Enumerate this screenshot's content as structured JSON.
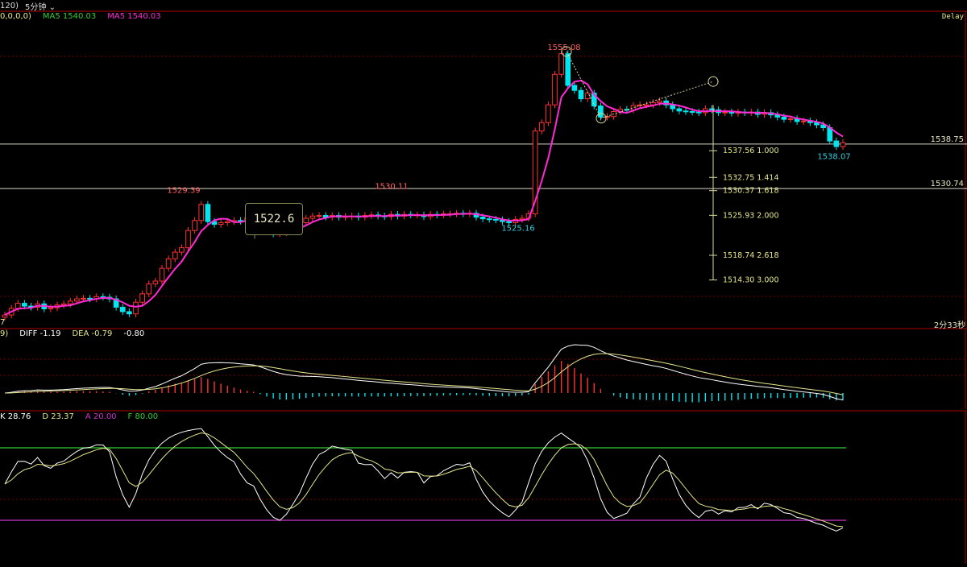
{
  "toolbar": {
    "left_fragment": "120)",
    "period": "5分钟"
  },
  "main_header": {
    "params": "0,0,0,0)",
    "ma5a": "MA5 1540.03",
    "ma5b": "MA5 1540.03",
    "delay": "Delay",
    "timer": "2分33秒",
    "bottom_left": "7"
  },
  "macd_header": {
    "params": "9)",
    "diff": "DIFF -1.19",
    "dea": "DEA -0.79",
    "macd": "-0.80"
  },
  "kd_header": {
    "k": "K 28.76",
    "d": "D 23.37",
    "a": "A 20.00",
    "f": "F 80.00"
  },
  "callout": "1522.6",
  "colors": {
    "up": "#ff3232",
    "down": "#00e5ee",
    "ma": "#ff2ad4",
    "line_white": "#ffffff",
    "line_yellow": "#e6e68a",
    "green_line": "#33cc33",
    "magenta_line": "#cc33cc",
    "grid": "#7a0000"
  },
  "chart_data": [
    {
      "type": "candlestick",
      "ylim": [
        1507,
        1558
      ],
      "price_labels": [
        {
          "text": "1529.39",
          "value": 1529.39
        },
        {
          "text": "1530.11",
          "value": 1530.11
        },
        {
          "text": "1525.16",
          "value": 1525.16
        },
        {
          "text": "1555.08",
          "value": 1555.08
        },
        {
          "text": "1538.07",
          "value": 1538.07
        }
      ],
      "hlines": [
        {
          "value": 1538.75,
          "label": "1538.75"
        },
        {
          "value": 1530.74,
          "label": "1530.74"
        }
      ],
      "fib_levels": [
        {
          "text": "1537.56  1.000",
          "value": 1537.56
        },
        {
          "text": "1532.75  1.414",
          "value": 1532.75
        },
        {
          "text": "1530.37  1.618",
          "value": 1530.37
        },
        {
          "text": "1525.93  2.000",
          "value": 1525.93
        },
        {
          "text": "1518.74  2.618",
          "value": 1518.74
        },
        {
          "text": "1514.30  3.000",
          "value": 1514.3
        }
      ],
      "close": [
        1508.0,
        1509.2,
        1510.1,
        1509.6,
        1509.4,
        1510.0,
        1509.1,
        1509.3,
        1509.8,
        1510.0,
        1510.5,
        1510.9,
        1511.0,
        1510.9,
        1511.3,
        1511.2,
        1510.9,
        1509.4,
        1508.6,
        1508.2,
        1510.3,
        1511.8,
        1513.6,
        1514.1,
        1516.4,
        1518.1,
        1519.3,
        1520.1,
        1523.2,
        1525.0,
        1527.9,
        1524.8,
        1524.3,
        1524.6,
        1524.8,
        1525.0,
        1524.9,
        1525.5,
        1525.8,
        1524.0,
        1523.0,
        1522.6,
        1522.8,
        1523.6,
        1524.2,
        1524.6,
        1525.4,
        1525.8,
        1525.9,
        1525.6,
        1525.9,
        1525.6,
        1525.7,
        1525.8,
        1525.6,
        1525.9,
        1526.0,
        1525.8,
        1525.7,
        1526.1,
        1525.8,
        1526.1,
        1526.0,
        1526.0,
        1525.7,
        1526.1,
        1526.0,
        1526.2,
        1526.2,
        1526.3,
        1526.2,
        1526.3,
        1525.6,
        1525.3,
        1525.2,
        1525.1,
        1524.8,
        1524.6,
        1525.2,
        1525.4,
        1526.2,
        1541.1,
        1542.6,
        1545.8,
        1551.3,
        1555.0,
        1549.3,
        1548.4,
        1546.9,
        1547.9,
        1545.6,
        1543.6,
        1543.7,
        1544.6,
        1545.0,
        1544.9,
        1545.7,
        1545.8,
        1545.8,
        1546.2,
        1546.5,
        1545.8,
        1545.1,
        1544.7,
        1544.6,
        1544.5,
        1544.4,
        1545.1,
        1544.9,
        1544.4,
        1544.5,
        1544.3,
        1544.5,
        1544.4,
        1544.5,
        1544.1,
        1544.4,
        1544.0,
        1543.6,
        1543.2,
        1543.3,
        1542.8,
        1542.9,
        1542.6,
        1542.2,
        1541.7,
        1539.3,
        1538.3,
        1539.0
      ]
    },
    {
      "type": "macd",
      "series": [
        {
          "name": "DIFF",
          "value": -1.19
        },
        {
          "name": "DEA",
          "value": -0.79
        },
        {
          "name": "MACD",
          "value": -0.8
        }
      ]
    },
    {
      "type": "kd",
      "ylim": [
        0,
        100
      ],
      "reference_lines": [
        {
          "name": "A",
          "value": 20
        },
        {
          "name": "F",
          "value": 80
        }
      ],
      "k_last": 28.76,
      "d_last": 23.37
    }
  ]
}
